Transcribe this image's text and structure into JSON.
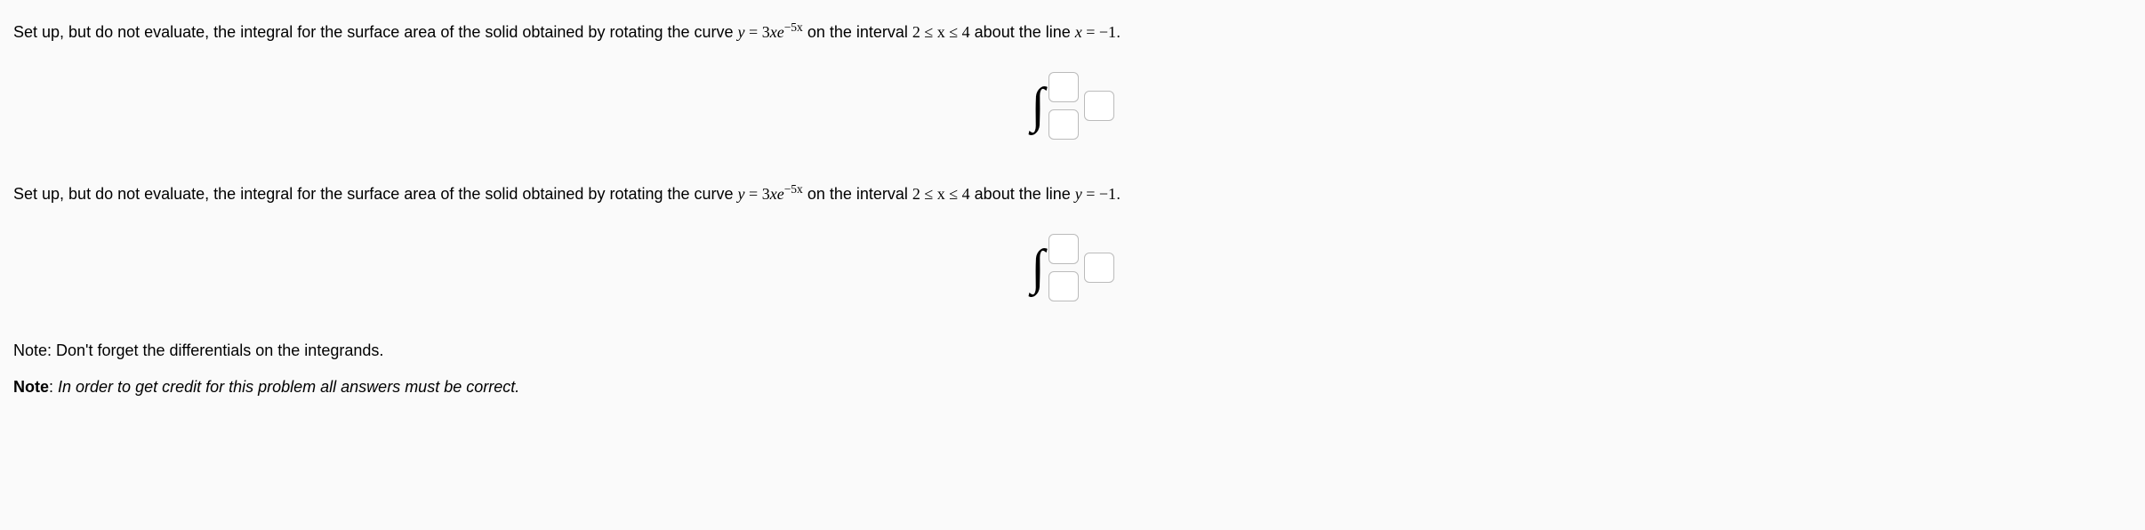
{
  "q1": {
    "pre": "Set up, but do not evaluate, the integral for the surface area of the solid obtained by rotating the curve ",
    "eq_lhs": "y",
    "eq_eq": " = ",
    "eq_rhs_coef": "3",
    "eq_rhs_var": "x",
    "eq_rhs_e": "e",
    "eq_rhs_exp": "−5x",
    "interval_pre": " on the interval ",
    "interval": "2 ≤ x ≤ 4",
    "about_pre": " about the line ",
    "axis_lhs": "x",
    "axis_eq": " = ",
    "axis_rhs": "−1",
    "period": "."
  },
  "q2": {
    "pre": "Set up, but do not evaluate, the integral for the surface area of the solid obtained by rotating the curve ",
    "eq_lhs": "y",
    "eq_eq": " = ",
    "eq_rhs_coef": "3",
    "eq_rhs_var": "x",
    "eq_rhs_e": "e",
    "eq_rhs_exp": "−5x",
    "interval_pre": " on the interval ",
    "interval": "2 ≤ x ≤ 4",
    "about_pre": " about the line ",
    "axis_lhs": "y",
    "axis_eq": " = ",
    "axis_rhs": "−1",
    "period": "."
  },
  "notes": {
    "n1": "Note: Don't forget the differentials on the integrands.",
    "n2_bold": "Note",
    "n2_sep": ": ",
    "n2_ital": "In order to get credit for this problem all answers must be correct."
  }
}
